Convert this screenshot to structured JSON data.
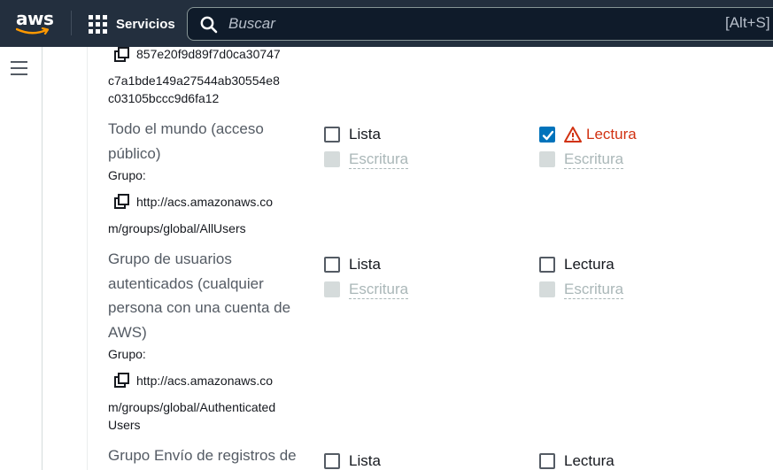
{
  "topnav": {
    "logo_text": "aws",
    "services_label": "Servicios",
    "search_placeholder": "Buscar",
    "search_shortcut": "[Alt+S]"
  },
  "grantees": [
    {
      "id_lines": [
        "857e20f9d89f7d0ca30747",
        "c7a1bde149a27544ab30554e8",
        "c03105bccc9d6fa12"
      ]
    },
    {
      "name_lines": [
        "Todo el mundo (acceso",
        "público)"
      ],
      "group_label": "Grupo:",
      "uri_lines": [
        "http://acs.amazonaws.co",
        "m/groups/global/AllUsers"
      ],
      "objects": {
        "list_label": "Lista",
        "list_checked": false,
        "write_label": "Escritura",
        "write_disabled": true
      },
      "acl": {
        "read_label": "Lectura",
        "read_checked": true,
        "read_warning": true,
        "write_label": "Escritura",
        "write_disabled": true
      }
    },
    {
      "name_lines": [
        "Grupo de usuarios",
        "autenticados (cualquier",
        "persona con una cuenta de",
        "AWS)"
      ],
      "group_label": "Grupo:",
      "uri_lines": [
        "http://acs.amazonaws.co",
        "m/groups/global/Authenticated",
        "Users"
      ],
      "objects": {
        "list_label": "Lista",
        "list_checked": false,
        "write_label": "Escritura",
        "write_disabled": true
      },
      "acl": {
        "read_label": "Lectura",
        "read_checked": false,
        "read_warning": false,
        "write_label": "Escritura",
        "write_disabled": true
      }
    },
    {
      "name_lines": [
        "Grupo Envío de registros de"
      ],
      "objects": {
        "list_label": "Lista",
        "list_checked": false
      },
      "acl": {
        "read_label": "Lectura",
        "read_checked": false
      }
    }
  ],
  "colors": {
    "nav_bg": "#232f3e",
    "checkbox_checked": "#0073bb",
    "warning": "#d13212",
    "disabled": "#d5dbdb"
  },
  "icons": [
    "search-icon",
    "grid-icon",
    "hamburger-icon",
    "copy-icon",
    "warning-icon",
    "checkmark-icon"
  ]
}
